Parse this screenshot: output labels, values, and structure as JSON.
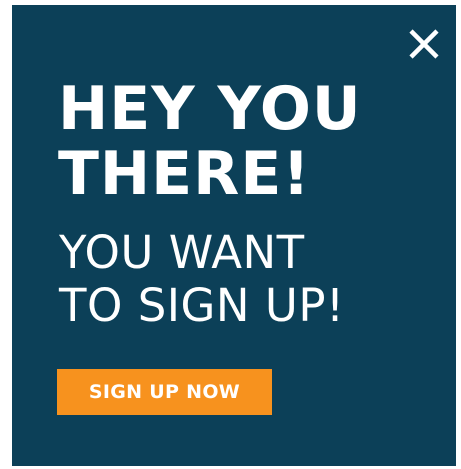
{
  "popup": {
    "background_color": "#0c4058",
    "close_icon": "close-icon",
    "headline_lines": [
      "HEY YOU",
      "THERE!"
    ],
    "subhead_lines": [
      "YOU WANT",
      "TO SIGN UP!"
    ],
    "cta": {
      "label": "SIGN UP NOW",
      "color": "#f7921e"
    }
  }
}
